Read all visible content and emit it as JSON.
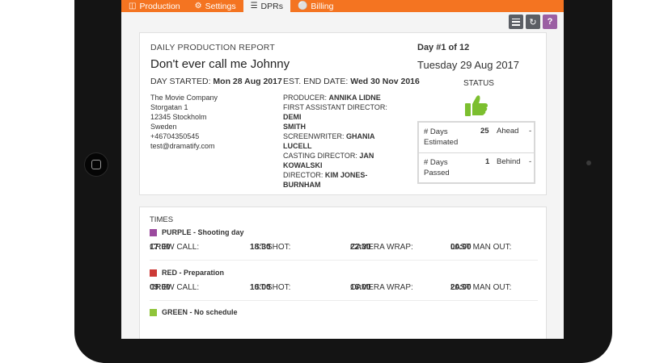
{
  "tabs": [
    {
      "icon": "film-icon",
      "label": "Production",
      "active": false
    },
    {
      "icon": "gear-icon",
      "label": "Settings",
      "active": false
    },
    {
      "icon": "list-icon",
      "label": "DPRs",
      "active": true
    },
    {
      "icon": "tag-icon",
      "label": "Billing",
      "active": false
    }
  ],
  "toolbar": {
    "list_icon": "list-icon",
    "refresh_icon": "refresh-icon",
    "help_label": "?"
  },
  "report": {
    "heading": "DAILY PRODUCTION REPORT",
    "title": "Don't ever call me Johnny",
    "day_started_label": "DAY STARTED:",
    "day_started_value": "Mon 28 Aug 2017",
    "end_date_label": "EST. END DATE:",
    "end_date_value": "Wed 30 Nov 2016",
    "day_number": "Day #1 of 12",
    "date": "Tuesday 29 Aug 2017",
    "status_label": "STATUS",
    "status_icon": "thumbs-up-icon",
    "company": [
      "The Movie Company",
      "Storgatan 1",
      "12345 Stockholm",
      "Sweden",
      "+46704350545",
      "test@dramatify.com"
    ],
    "crew": {
      "producer_label": "PRODUCER:",
      "producer": "ANNIKA LIDNE",
      "ad_label": "FIRST ASSISTANT DIRECTOR:",
      "ad_first": "DEMI",
      "ad_last": "SMITH",
      "screenwriter_label": "SCREENWRITER:",
      "screenwriter": "GHANIA LUCELL",
      "casting_label": "CASTING DIRECTOR:",
      "casting": "JAN KOWALSKI",
      "director_label": "DIRECTOR:",
      "director": "KIM JONES-BURNHAM"
    },
    "stats": {
      "estimated_label": "# Days Estimated",
      "estimated_value": "25",
      "estimated_state": "Ahead",
      "estimated_dash": "-",
      "passed_label": "# Days Passed",
      "passed_value": "1",
      "passed_state": "Behind",
      "passed_dash": "-"
    }
  },
  "times": {
    "heading": "TIMES",
    "labels": {
      "crew_call": "CREW CALL:",
      "first_shot": "1ST SHOT:",
      "camera_wrap": "CAMERA WRAP:",
      "last_man": "LAST MAN OUT:"
    },
    "schedules": [
      {
        "name": "PURPLE - Shooting day",
        "color": "#9b4a9e",
        "crew_call": "17:00",
        "first_shot": "18:30",
        "camera_wrap": "22:30",
        "last_man": "00:00"
      },
      {
        "name": "RED - Preparation",
        "color": "#cc3a36",
        "crew_call": "09:00",
        "first_shot": "10:00",
        "camera_wrap": "16:00",
        "last_man": "20:00"
      },
      {
        "name": "GREEN - No schedule",
        "color": "#8fc43a"
      }
    ]
  },
  "colors": {
    "accent": "#f47421",
    "help": "#9b5fa3",
    "thumb": "#7cbf2f"
  }
}
